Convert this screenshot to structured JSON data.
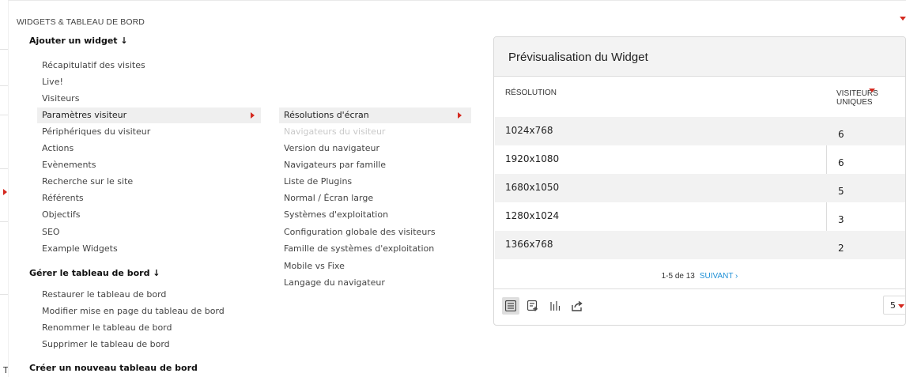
{
  "menu_title": "WIDGETS & TABLEAU DE BORD",
  "edge_letter": "T",
  "sections": {
    "add_widget": "Ajouter un widget ↓",
    "manage_dashboard": "Gérer le tableau de bord ↓",
    "create_dashboard": "Créer un nouveau tableau de bord"
  },
  "categories": [
    "Récapitulatif des visites",
    "Live!",
    "Visiteurs",
    "Paramètres visiteur",
    "Périphériques du visiteur",
    "Actions",
    "Evènements",
    "Recherche sur le site",
    "Référents",
    "Objectifs",
    "SEO",
    "Example Widgets"
  ],
  "active_category": "Paramètres visiteur",
  "subcategories": [
    "Résolutions d'écran",
    "Navigateurs du visiteur",
    "Version du navigateur",
    "Navigateurs par famille",
    "Liste de Plugins",
    "Normal / Écran large",
    "Systèmes d'exploitation",
    "Configuration globale des visiteurs",
    "Famille de systèmes d'exploitation",
    "Mobile vs Fixe",
    "Langage du navigateur"
  ],
  "active_subcategory": "Résolutions d'écran",
  "disabled_subcategory": "Navigateurs du visiteur",
  "dashboard_actions": [
    "Restaurer le tableau de bord",
    "Modifier mise en page du tableau de bord",
    "Renommer le tableau de bord",
    "Supprimer le tableau de bord"
  ],
  "preview": {
    "title": "Prévisualisation du Widget",
    "col_label": "RÉSOLUTION",
    "col_value_line1": "VISITEURS",
    "col_value_line2": "UNIQUES",
    "rows": [
      {
        "label": "1024x768",
        "value": "6"
      },
      {
        "label": "1920x1080",
        "value": "6"
      },
      {
        "label": "1680x1050",
        "value": "5"
      },
      {
        "label": "1280x1024",
        "value": "3"
      },
      {
        "label": "1366x768",
        "value": "2"
      }
    ],
    "pager_text": "1-5 de 13",
    "pager_next": "SUIVANT ›",
    "limit_value": "5",
    "footer_icons": [
      "table-view-icon",
      "table-more-columns-icon",
      "bar-chart-icon",
      "export-icon"
    ]
  },
  "colors": {
    "accent_red": "#d4291f",
    "link_blue": "#1d8fd6",
    "active_row": "#efefef"
  }
}
